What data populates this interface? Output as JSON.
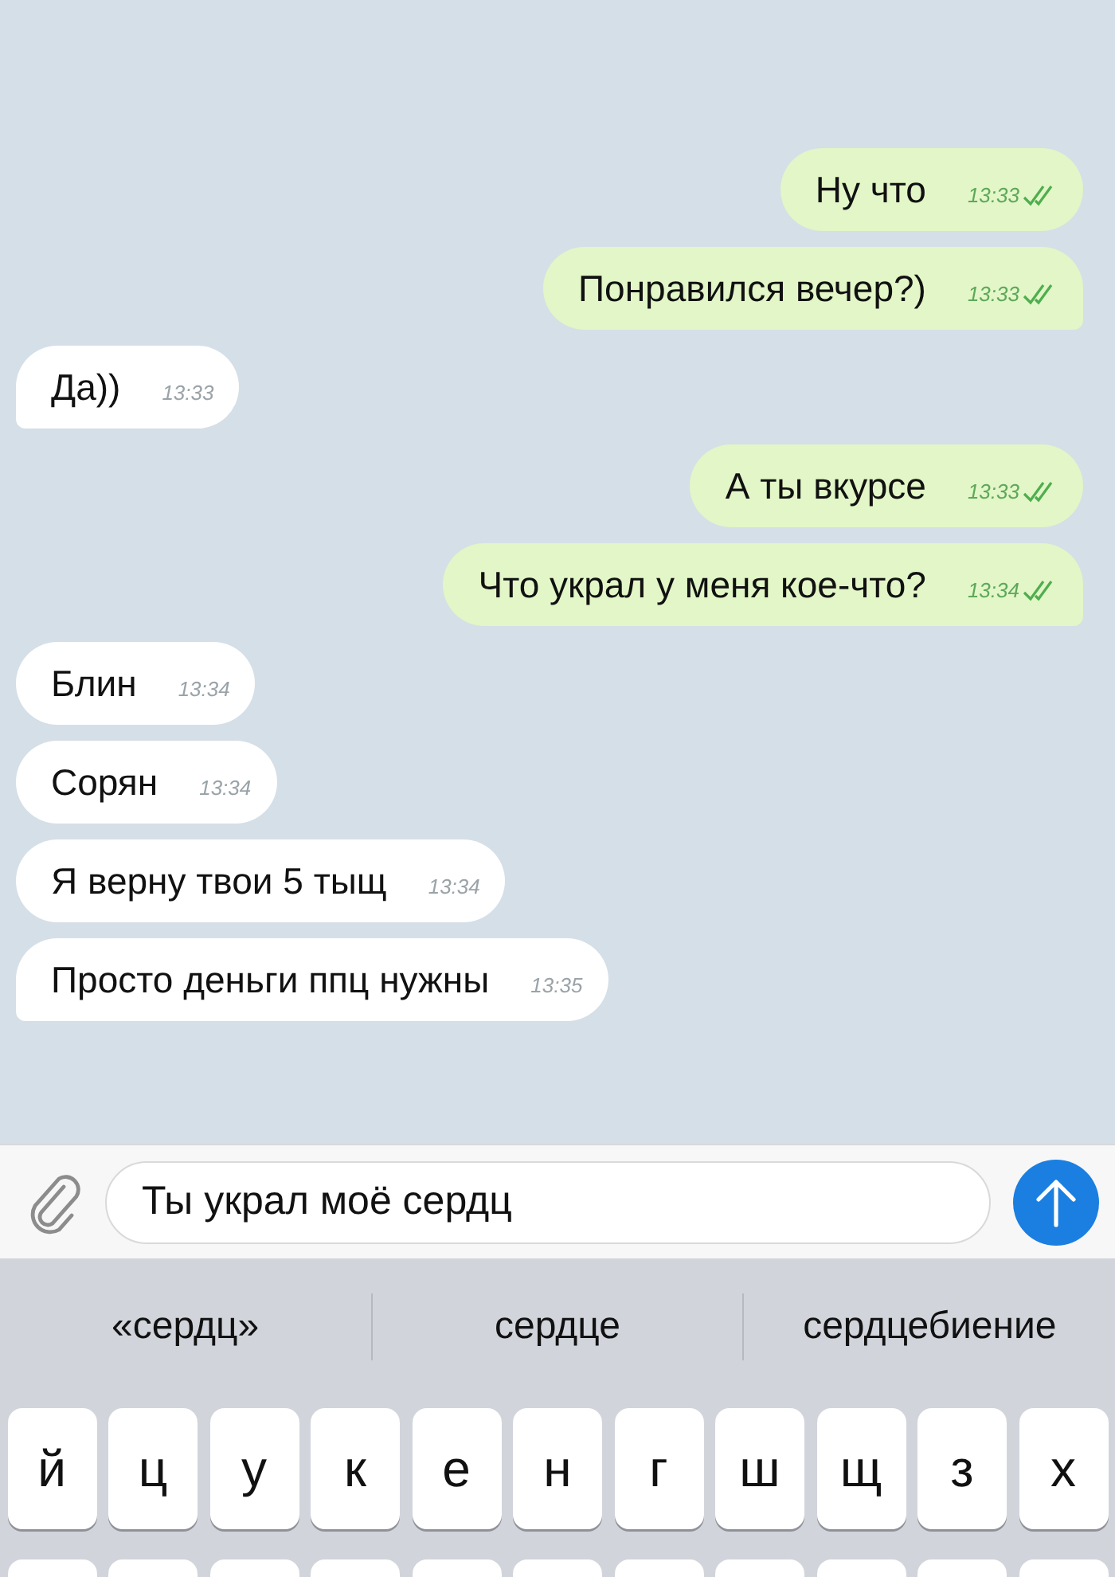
{
  "messages": [
    {
      "kind": "outgoing",
      "text": "Ну что",
      "time": "13:33",
      "read": true
    },
    {
      "kind": "outgoing",
      "text": "Понравился вечер?)",
      "time": "13:33",
      "read": true
    },
    {
      "kind": "incoming",
      "text": "Да))",
      "time": "13:33"
    },
    {
      "kind": "outgoing",
      "text": "А ты вкурсе",
      "time": "13:33",
      "read": true
    },
    {
      "kind": "outgoing",
      "text": "Что украл у меня кое-что?",
      "time": "13:34",
      "read": true
    },
    {
      "kind": "incoming",
      "text": "Блин",
      "time": "13:34"
    },
    {
      "kind": "incoming",
      "text": "Сорян",
      "time": "13:34"
    },
    {
      "kind": "incoming",
      "text": "Я верну твои 5 тыщ",
      "time": "13:34"
    },
    {
      "kind": "incoming",
      "text": "Просто деньги ппц нужны",
      "time": "13:35"
    }
  ],
  "composer": {
    "value": "Ты украл моё сердц"
  },
  "suggestions": [
    "«сердц»",
    "сердце",
    "сердцебиение"
  ],
  "keyboard": {
    "rows": [
      [
        "й",
        "ц",
        "у",
        "к",
        "е",
        "н",
        "г",
        "ш",
        "щ",
        "з",
        "х"
      ]
    ]
  }
}
